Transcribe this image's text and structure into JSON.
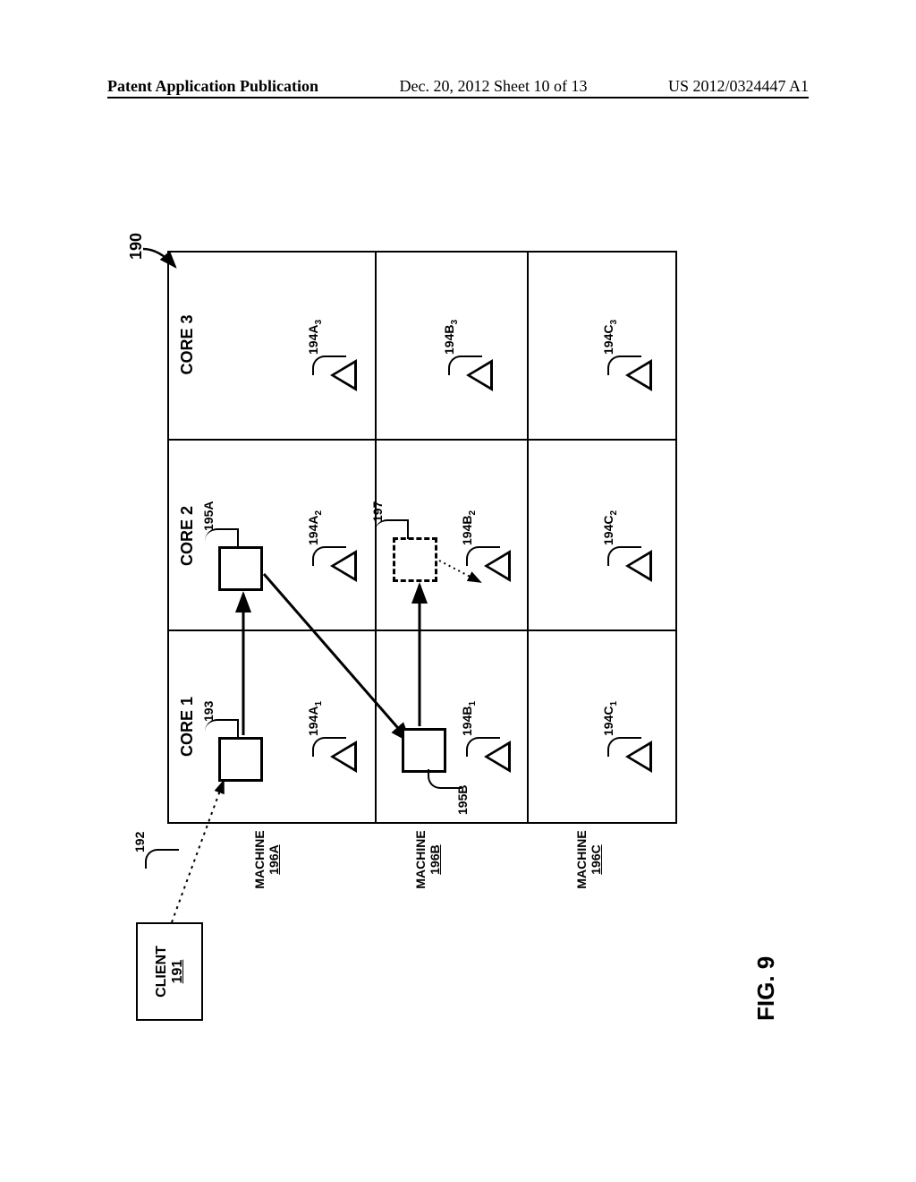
{
  "header": {
    "left": "Patent Application Publication",
    "center": "Dec. 20, 2012  Sheet 10 of 13",
    "right": "US 2012/0324447 A1"
  },
  "fig": {
    "label": "FIG. 9",
    "ref": "190"
  },
  "client": {
    "name": "CLIENT",
    "num": "191"
  },
  "cores": {
    "c1": "CORE 1",
    "c2": "CORE 2",
    "c3": "CORE 3"
  },
  "machines": {
    "a": {
      "label": "MACHINE",
      "num": "196A"
    },
    "b": {
      "label": "MACHINE",
      "num": "196B"
    },
    "c": {
      "label": "MACHINE",
      "num": "196C"
    }
  },
  "refs": {
    "r192": "192",
    "r193": "193",
    "r195a": "195A",
    "r195b": "195B",
    "r197": "197"
  },
  "tri": {
    "a1": {
      "base": "194A",
      "sub": "1"
    },
    "a2": {
      "base": "194A",
      "sub": "2"
    },
    "a3": {
      "base": "194A",
      "sub": "3"
    },
    "b1": {
      "base": "194B",
      "sub": "1"
    },
    "b2": {
      "base": "194B",
      "sub": "2"
    },
    "b3": {
      "base": "194B",
      "sub": "3"
    },
    "c1": {
      "base": "194C",
      "sub": "1"
    },
    "c2": {
      "base": "194C",
      "sub": "2"
    },
    "c3": {
      "base": "194C",
      "sub": "3"
    }
  }
}
